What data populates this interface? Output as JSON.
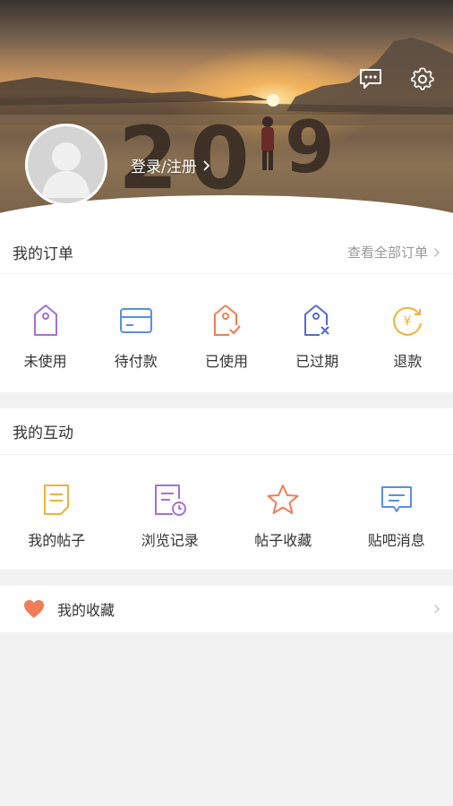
{
  "header": {
    "login_label": "登录/注册",
    "icons": {
      "message": "message-icon",
      "settings": "gear-icon",
      "avatar": "avatar-placeholder"
    },
    "banner_text": "2019"
  },
  "orders": {
    "title": "我的订单",
    "view_all": "查看全部订单",
    "items": [
      {
        "label": "未使用",
        "icon": "tag-icon",
        "color": "#a66fd6"
      },
      {
        "label": "待付款",
        "icon": "card-icon",
        "color": "#5a8fe0"
      },
      {
        "label": "已使用",
        "icon": "tag-check-icon",
        "color": "#ee7d58"
      },
      {
        "label": "已过期",
        "icon": "tag-expired-icon",
        "color": "#5569d6"
      },
      {
        "label": "退款",
        "icon": "refund-icon",
        "color": "#f0b23a"
      }
    ]
  },
  "interactions": {
    "title": "我的互动",
    "items": [
      {
        "label": "我的帖子",
        "icon": "document-icon",
        "color": "#f0b23a"
      },
      {
        "label": "浏览记录",
        "icon": "history-icon",
        "color": "#a66fd6"
      },
      {
        "label": "帖子收藏",
        "icon": "star-icon",
        "color": "#ee7d58"
      },
      {
        "label": "贴吧消息",
        "icon": "chat-icon",
        "color": "#5a8fe0"
      }
    ]
  },
  "favorites": {
    "label": "我的收藏",
    "icon": "heart-icon",
    "color": "#ee7d58"
  }
}
